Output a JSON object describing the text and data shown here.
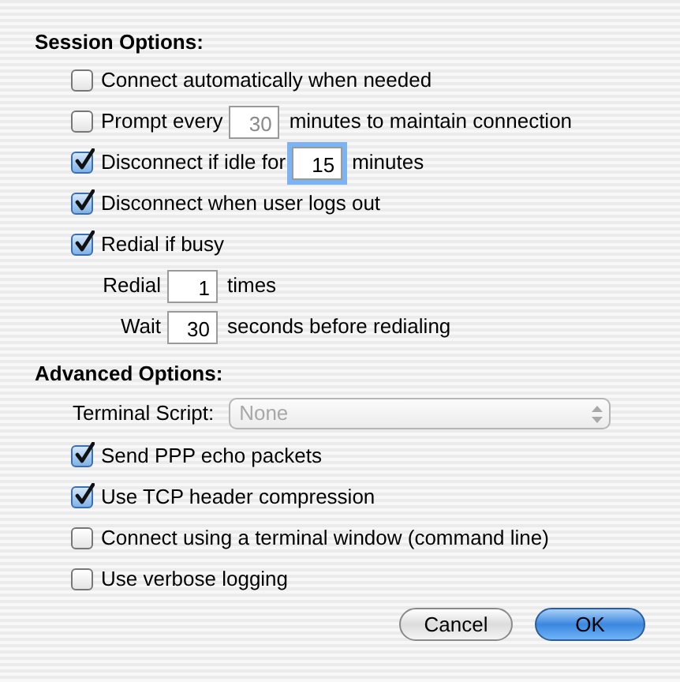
{
  "session_options": {
    "heading": "Session Options:",
    "items": [
      {
        "kind": "check",
        "label": "Connect automatically when needed",
        "checked": false
      },
      {
        "kind": "check_field",
        "label": "Prompt every",
        "value": "30",
        "after": "minutes to maintain connection",
        "checked": false,
        "disabled": true,
        "focused": false
      },
      {
        "kind": "check_field",
        "label": "Disconnect if idle for",
        "value": "15",
        "after": "minutes",
        "checked": true,
        "disabled": false,
        "focused": true
      },
      {
        "kind": "check",
        "label": "Disconnect when user logs out",
        "checked": true
      },
      {
        "kind": "check",
        "label": "Redial if busy",
        "checked": true
      },
      {
        "kind": "field",
        "label": "Redial",
        "value": "1",
        "after": "times",
        "disabled": false,
        "focused": false
      },
      {
        "kind": "field",
        "label": "Wait",
        "value": "30",
        "after": "seconds before redialing",
        "disabled": false,
        "focused": false
      }
    ]
  },
  "advanced_options": {
    "heading": "Advanced Options:",
    "items": [
      {
        "kind": "popup",
        "label": "Terminal Script:",
        "value": "None",
        "disabled": true
      },
      {
        "kind": "check",
        "label": "Send PPP echo packets",
        "checked": true
      },
      {
        "kind": "check",
        "label": "Use TCP header compression",
        "checked": true
      },
      {
        "kind": "check",
        "label": "Connect using a terminal window (command line)",
        "checked": false
      },
      {
        "kind": "check",
        "label": "Use verbose logging",
        "checked": false
      }
    ]
  },
  "buttons": [
    {
      "label": "Cancel",
      "default": false
    },
    {
      "label": "OK",
      "default": true
    }
  ]
}
